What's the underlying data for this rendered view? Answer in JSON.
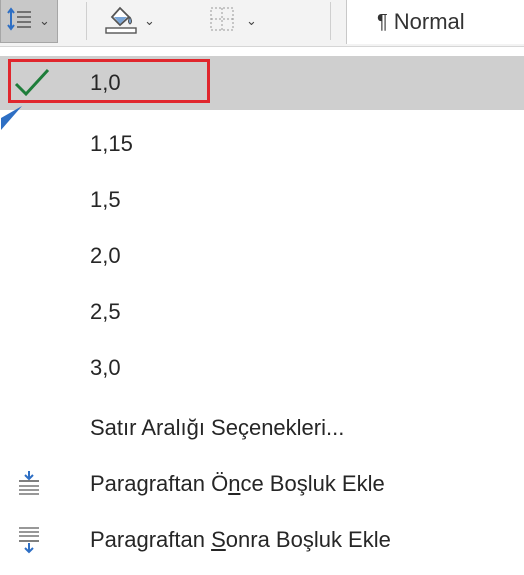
{
  "ribbon": {
    "style_name": "Normal",
    "style_mark": "¶",
    "icons": [
      "line-spacing-icon",
      "shading-icon",
      "borders-icon"
    ]
  },
  "menu": {
    "items": [
      {
        "label": "1,0",
        "selected": true
      },
      {
        "label": "1,15",
        "selected": false
      },
      {
        "label": "1,5",
        "selected": false
      },
      {
        "label": "2,0",
        "selected": false
      },
      {
        "label": "2,5",
        "selected": false
      },
      {
        "label": "3,0",
        "selected": false
      }
    ],
    "options_label": "Satır Aralığı Seçenekleri...",
    "space_before": {
      "pre": "Paragraftan Ö",
      "accel": "n",
      "post": "ce Boşluk Ekle"
    },
    "space_after": {
      "pre": "Paragraftan ",
      "accel": "S",
      "post": "onra Boşluk Ekle"
    }
  },
  "colors": {
    "selected_bg": "#cfcfcf",
    "checkmark": "#1e7d3a",
    "highlight_border": "#e0262d",
    "icon_blue": "#2e6fc4"
  }
}
